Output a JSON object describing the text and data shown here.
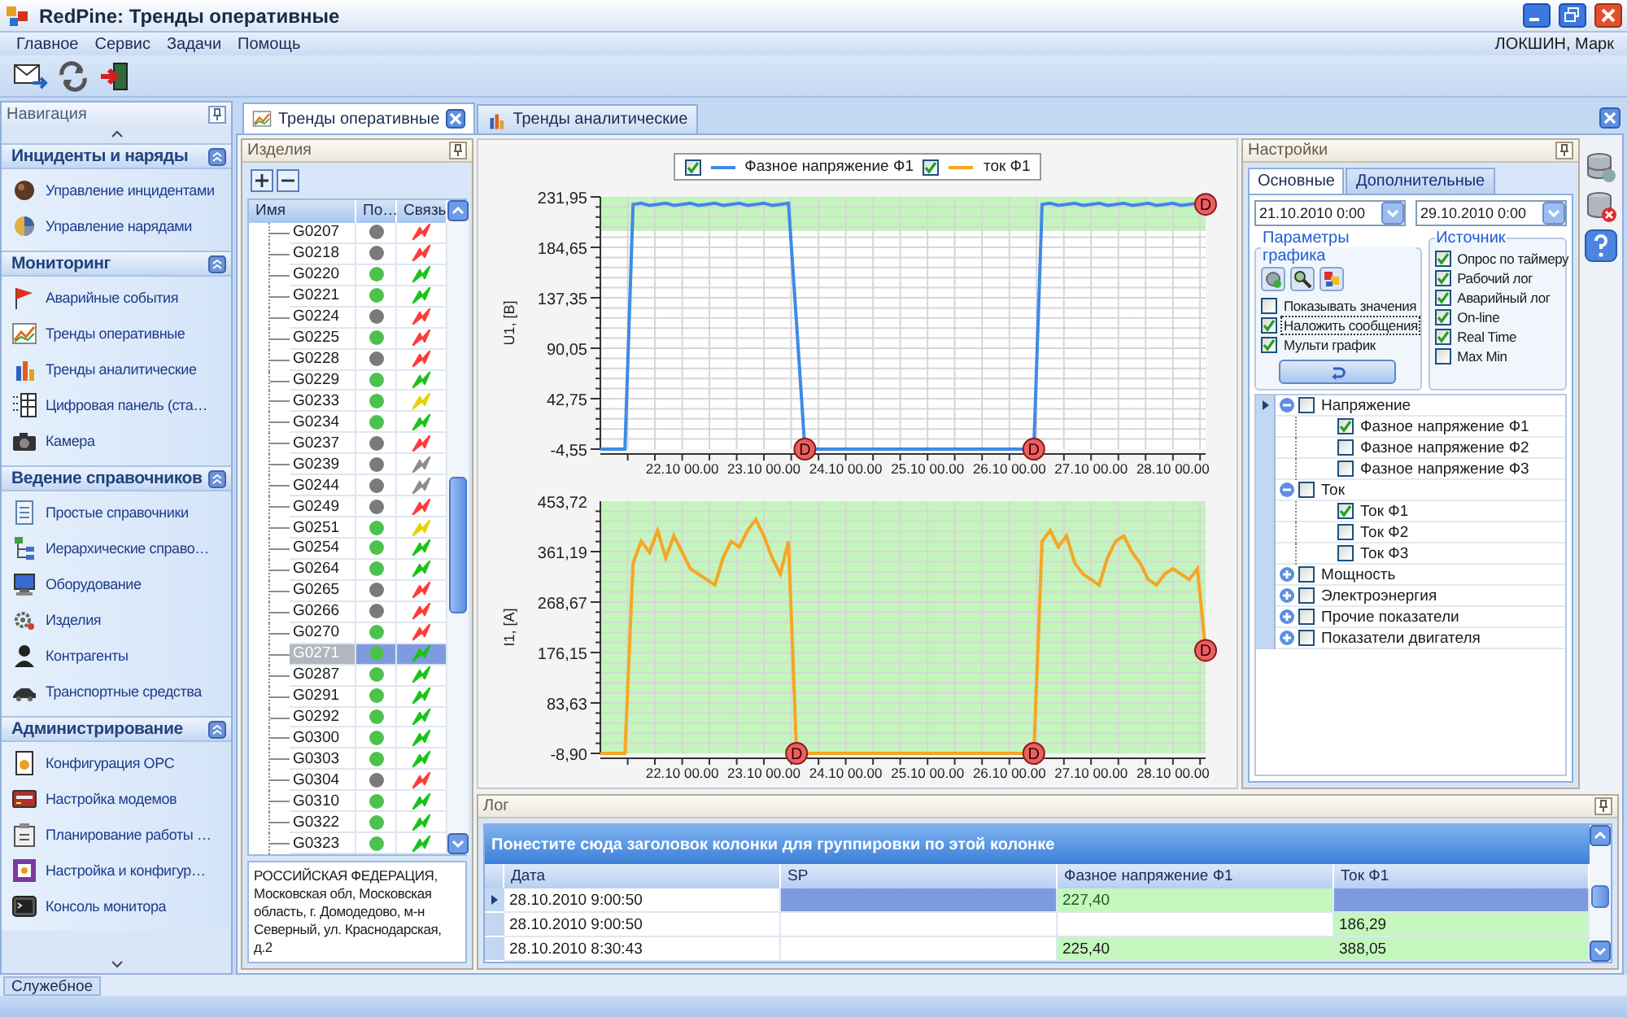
{
  "window": {
    "title": "RedPine: Тренды оперативные"
  },
  "menu": [
    "Главное",
    "Сервис",
    "Задачи",
    "Помощь"
  ],
  "user": "ЛОКШИН, Марк",
  "navigation": {
    "title": "Навигация",
    "groups": [
      {
        "title": "Инциденты и наряды",
        "items": [
          "Управление инцидентами",
          "Управление нарядами"
        ]
      },
      {
        "title": "Мониторинг",
        "items": [
          "Аварийные события",
          "Тренды оперативные",
          "Тренды аналитические",
          "Цифровая панель (ста…",
          "Камера"
        ]
      },
      {
        "title": "Ведение справочников",
        "items": [
          "Простые справочники",
          "Иерархические справо…",
          "Оборудование",
          "Изделия",
          "Контрагенты",
          "Транспортные средства"
        ]
      },
      {
        "title": "Администрирование",
        "items": [
          "Конфигурация  OPC",
          "Настройка модемов",
          "Планирование работы …",
          "Настройка и конфигур…",
          "Консоль монитора"
        ]
      }
    ]
  },
  "tabs": [
    {
      "label": "Тренды оперативные",
      "selected": true
    },
    {
      "label": "Тренды аналитические",
      "selected": false
    }
  ],
  "devices": {
    "title": "Изделия",
    "columns": [
      "Имя",
      "По…",
      "Связь"
    ],
    "rows": [
      {
        "name": "G0207",
        "selected": false,
        "state": {
          "color": "#7a7a7a"
        },
        "link": {
          "color": "#ff3b3b"
        }
      },
      {
        "name": "G0218",
        "selected": false,
        "state": {
          "color": "#7a7a7a"
        },
        "link": {
          "color": "#ff3b3b"
        }
      },
      {
        "name": "G0220",
        "selected": false,
        "state": {
          "color": "#4cc24c"
        },
        "link": {
          "color": "#19c419"
        }
      },
      {
        "name": "G0221",
        "selected": false,
        "state": {
          "color": "#4cc24c"
        },
        "link": {
          "color": "#19c419"
        }
      },
      {
        "name": "G0224",
        "selected": false,
        "state": {
          "color": "#7a7a7a"
        },
        "link": {
          "color": "#ff3b3b"
        }
      },
      {
        "name": "G0225",
        "selected": false,
        "state": {
          "color": "#4cc24c"
        },
        "link": {
          "color": "#ff3b3b"
        }
      },
      {
        "name": "G0228",
        "selected": false,
        "state": {
          "color": "#7a7a7a"
        },
        "link": {
          "color": "#ff3b3b"
        }
      },
      {
        "name": "G0229",
        "selected": false,
        "state": {
          "color": "#4cc24c"
        },
        "link": {
          "color": "#19c419"
        }
      },
      {
        "name": "G0233",
        "selected": false,
        "state": {
          "color": "#4cc24c"
        },
        "link": {
          "color": "#e6d200"
        }
      },
      {
        "name": "G0234",
        "selected": false,
        "state": {
          "color": "#4cc24c"
        },
        "link": {
          "color": "#19c419"
        }
      },
      {
        "name": "G0237",
        "selected": false,
        "state": {
          "color": "#7a7a7a"
        },
        "link": {
          "color": "#ff3b3b"
        }
      },
      {
        "name": "G0239",
        "selected": false,
        "state": {
          "color": "#7a7a7a"
        },
        "link": {
          "color": "#8c8c8c"
        }
      },
      {
        "name": "G0244",
        "selected": false,
        "state": {
          "color": "#7a7a7a"
        },
        "link": {
          "color": "#8c8c8c"
        }
      },
      {
        "name": "G0249",
        "selected": false,
        "state": {
          "color": "#7a7a7a"
        },
        "link": {
          "color": "#ff3b3b"
        }
      },
      {
        "name": "G0251",
        "selected": false,
        "state": {
          "color": "#4cc24c"
        },
        "link": {
          "color": "#e6d200"
        }
      },
      {
        "name": "G0254",
        "selected": false,
        "state": {
          "color": "#4cc24c"
        },
        "link": {
          "color": "#19c419"
        }
      },
      {
        "name": "G0264",
        "selected": false,
        "state": {
          "color": "#4cc24c"
        },
        "link": {
          "color": "#19c419"
        }
      },
      {
        "name": "G0265",
        "selected": false,
        "state": {
          "color": "#7a7a7a"
        },
        "link": {
          "color": "#ff3b3b"
        }
      },
      {
        "name": "G0266",
        "selected": false,
        "state": {
          "color": "#7a7a7a"
        },
        "link": {
          "color": "#ff3b3b"
        }
      },
      {
        "name": "G0270",
        "selected": false,
        "state": {
          "color": "#4cc24c"
        },
        "link": {
          "color": "#ff3b3b"
        }
      },
      {
        "name": "G0271",
        "selected": true,
        "state": {
          "color": "#4cc24c"
        },
        "link": {
          "color": "#19c419"
        }
      },
      {
        "name": "G0287",
        "selected": false,
        "state": {
          "color": "#4cc24c"
        },
        "link": {
          "color": "#19c419"
        }
      },
      {
        "name": "G0291",
        "selected": false,
        "state": {
          "color": "#4cc24c"
        },
        "link": {
          "color": "#19c419"
        }
      },
      {
        "name": "G0292",
        "selected": false,
        "state": {
          "color": "#4cc24c"
        },
        "link": {
          "color": "#19c419"
        }
      },
      {
        "name": "G0300",
        "selected": false,
        "state": {
          "color": "#4cc24c"
        },
        "link": {
          "color": "#19c419"
        }
      },
      {
        "name": "G0303",
        "selected": false,
        "state": {
          "color": "#4cc24c"
        },
        "link": {
          "color": "#19c419"
        }
      },
      {
        "name": "G0304",
        "selected": false,
        "state": {
          "color": "#7a7a7a"
        },
        "link": {
          "color": "#ff3b3b"
        }
      },
      {
        "name": "G0310",
        "selected": false,
        "state": {
          "color": "#4cc24c"
        },
        "link": {
          "color": "#19c419"
        }
      },
      {
        "name": "G0322",
        "selected": false,
        "state": {
          "color": "#4cc24c"
        },
        "link": {
          "color": "#19c419"
        }
      },
      {
        "name": "G0323",
        "selected": false,
        "state": {
          "color": "#4cc24c"
        },
        "link": {
          "color": "#19c419"
        }
      }
    ],
    "address": "РОССИЙСКАЯ ФЕДЕРАЦИЯ, Московская обл, Московская область, г. Домодедово, м-н Северный, ул. Краснодарская, д.2"
  },
  "trends": {
    "legend": [
      {
        "checked": true
      },
      {
        "checked": true
      }
    ],
    "charts": [
      {
        "markers": [
          {
            "label": "D",
            "kind": "drop"
          },
          {
            "label": "D",
            "kind": "rise"
          },
          {
            "label": "D",
            "kind": "end"
          }
        ],
        "chart_data": {
          "type": "line",
          "ylabel": "U1, [B]",
          "ylim": [
            -4.55,
            231.95
          ],
          "grid": true,
          "categories": [
            null,
            null,
            null,
            null,
            null,
            null,
            null,
            null,
            null,
            null,
            "22.10 00.00",
            null,
            null,
            null,
            null,
            null,
            null,
            null,
            null,
            null,
            "23.10 00.00",
            null,
            null,
            null,
            null,
            null,
            null,
            null,
            null,
            null,
            "24.10 00.00",
            null,
            null,
            null,
            null,
            null,
            null,
            null,
            null,
            null,
            "25.10 00.00",
            null,
            null,
            null,
            null,
            null,
            null,
            null,
            null,
            null,
            "26.10 00.00",
            null,
            null,
            null,
            null,
            null,
            null,
            null,
            null,
            null,
            "27.10 00.00",
            null,
            null,
            null,
            null,
            null,
            null,
            null,
            null,
            null,
            "28.10 00.00",
            null,
            null,
            null,
            null
          ],
          "yticks": [
            {
              "value": -4.55,
              "label": "-4,55"
            },
            {
              "value": 42.75,
              "label": "42,75"
            },
            {
              "value": 90.05,
              "label": "90,05"
            },
            {
              "value": 137.35,
              "label": "137,35"
            },
            {
              "value": 184.65,
              "label": "184,65"
            },
            {
              "value": 231.95,
              "label": "231,95"
            }
          ],
          "series": [
            {
              "name": "Фазное напряжение Ф1",
              "color": "#3d8ae8",
              "values": [
                -4.5,
                -4.5,
                -4.5,
                -4.5,
                225,
                226,
                224,
                225,
                226,
                224,
                225,
                226,
                224,
                225,
                226,
                224,
                225,
                226,
                224,
                225,
                226,
                224,
                225,
                226,
                113,
                -4.5,
                -4.5,
                -4.5,
                -4.5,
                -4.5,
                -4.5,
                -4.5,
                -4.5,
                -4.5,
                -4.5,
                -4.5,
                -4.5,
                -4.5,
                -4.5,
                -4.5,
                -4.5,
                -4.5,
                -4.5,
                -4.5,
                -4.5,
                -4.5,
                -4.5,
                -4.5,
                -4.5,
                -4.5,
                -4.5,
                -4.5,
                -4.5,
                -4.5,
                225,
                226,
                224,
                225,
                226,
                224,
                225,
                226,
                224,
                225,
                226,
                224,
                225,
                226,
                224,
                225,
                226,
                224,
                225,
                226,
                225
              ]
            }
          ]
        }
      },
      {
        "markers": [
          {
            "label": "D",
            "kind": "drop"
          },
          {
            "label": "D",
            "kind": "rise"
          },
          {
            "label": "D",
            "kind": "end"
          }
        ],
        "chart_data": {
          "type": "line",
          "ylabel": "I1, [A]",
          "ylim": [
            -8.9,
            453.72
          ],
          "grid": true,
          "categories": [
            null,
            null,
            null,
            null,
            null,
            null,
            null,
            null,
            null,
            null,
            "22.10 00.00",
            null,
            null,
            null,
            null,
            null,
            null,
            null,
            null,
            null,
            "23.10 00.00",
            null,
            null,
            null,
            null,
            null,
            null,
            null,
            null,
            null,
            "24.10 00.00",
            null,
            null,
            null,
            null,
            null,
            null,
            null,
            null,
            null,
            "25.10 00.00",
            null,
            null,
            null,
            null,
            null,
            null,
            null,
            null,
            null,
            "26.10 00.00",
            null,
            null,
            null,
            null,
            null,
            null,
            null,
            null,
            null,
            "27.10 00.00",
            null,
            null,
            null,
            null,
            null,
            null,
            null,
            null,
            null,
            "28.10 00.00",
            null,
            null,
            null,
            null
          ],
          "yticks": [
            {
              "value": -8.9,
              "label": "-8,90"
            },
            {
              "value": 83.63,
              "label": "83,63"
            },
            {
              "value": 176.15,
              "label": "176,15"
            },
            {
              "value": 268.67,
              "label": "268,67"
            },
            {
              "value": 361.19,
              "label": "361,19"
            },
            {
              "value": 453.72,
              "label": "453,72"
            }
          ],
          "series": [
            {
              "name": "ток Ф1",
              "color": "#f5a623",
              "values": [
                -8.9,
                -8.9,
                -8.9,
                -8.9,
                340,
                380,
                360,
                400,
                350,
                390,
                360,
                330,
                320,
                310,
                300,
                350,
                380,
                370,
                400,
                420,
                390,
                350,
                320,
                380,
                -8.9,
                -8.9,
                -8.9,
                -8.9,
                -8.9,
                -8.9,
                -8.9,
                -8.9,
                -8.9,
                -8.9,
                -8.9,
                -8.9,
                -8.9,
                -8.9,
                -8.9,
                -8.9,
                -8.9,
                -8.9,
                -8.9,
                -8.9,
                -8.9,
                -8.9,
                -8.9,
                -8.9,
                -8.9,
                -8.9,
                -8.9,
                -8.9,
                -8.9,
                -8.9,
                380,
                400,
                370,
                390,
                340,
                320,
                310,
                300,
                350,
                380,
                390,
                360,
                340,
                310,
                300,
                320,
                330,
                320,
                310,
                330,
                180
              ]
            }
          ]
        }
      }
    ]
  },
  "settings": {
    "title": "Настройки",
    "tabs": [
      {
        "label": "Основные",
        "selected": true
      },
      {
        "label": "Дополнительные",
        "selected": false
      }
    ],
    "date_from": "21.10.2010 0:00",
    "date_to": "29.10.2010 0:00",
    "chart_params": {
      "title": "Параметры графика",
      "options": [
        {
          "label": "Показывать значения",
          "checked": false,
          "focused": false
        },
        {
          "label": "Наложить сообщения",
          "checked": true,
          "focused": true
        },
        {
          "label": "Мульти график",
          "checked": true,
          "focused": false
        }
      ]
    },
    "source": {
      "title": "Источник",
      "options": [
        {
          "label": "Опрос по таймеру",
          "checked": true
        },
        {
          "label": "Рабочий лог",
          "checked": true
        },
        {
          "label": "Аварийный лог",
          "checked": true
        },
        {
          "label": "On-line",
          "checked": true
        },
        {
          "label": "Real Time",
          "checked": true
        },
        {
          "label": "Max Min",
          "checked": false
        }
      ]
    },
    "tree": [
      {
        "label": "Напряжение",
        "checked": false,
        "selected": true,
        "expanded": true,
        "children": [
          {
            "label": "Фазное напряжение Ф1",
            "checked": true,
            "selected": false
          },
          {
            "label": "Фазное напряжение Ф2",
            "checked": false,
            "selected": false
          },
          {
            "label": "Фазное напряжение Ф3",
            "checked": false,
            "selected": false
          }
        ]
      },
      {
        "label": "Ток",
        "checked": false,
        "selected": false,
        "expanded": true,
        "children": [
          {
            "label": "Ток Ф1",
            "checked": true,
            "selected": false
          },
          {
            "label": "Ток Ф2",
            "checked": false,
            "selected": false
          },
          {
            "label": "Ток Ф3",
            "checked": false,
            "selected": false
          }
        ]
      },
      {
        "label": "Мощность",
        "checked": false,
        "selected": false,
        "expanded": false
      },
      {
        "label": "Электроэнергия",
        "checked": false,
        "selected": false,
        "expanded": false
      },
      {
        "label": "Прочие показатели",
        "checked": false,
        "selected": false,
        "expanded": false
      },
      {
        "label": "Показатели двигателя",
        "checked": false,
        "selected": false,
        "expanded": false
      }
    ]
  },
  "log": {
    "title": "Лог",
    "group_hint": "Понестите сюда заголовок колонки для группировки по этой колонке",
    "columns": [
      "Дата",
      "SP",
      "Фазное напряжение Ф1",
      "Ток Ф1"
    ],
    "rows": [
      {
        "selected": true,
        "cells": [
          "28.10.2010 9:00:50",
          null,
          "227,40",
          null
        ]
      },
      {
        "selected": false,
        "cells": [
          "28.10.2010 9:00:50",
          null,
          null,
          "186,29"
        ]
      },
      {
        "selected": false,
        "cells": [
          "28.10.2010 8:30:43",
          null,
          "225,40",
          "388,05"
        ]
      }
    ]
  },
  "status_bar": {
    "tabs": [
      "Служебное"
    ]
  }
}
